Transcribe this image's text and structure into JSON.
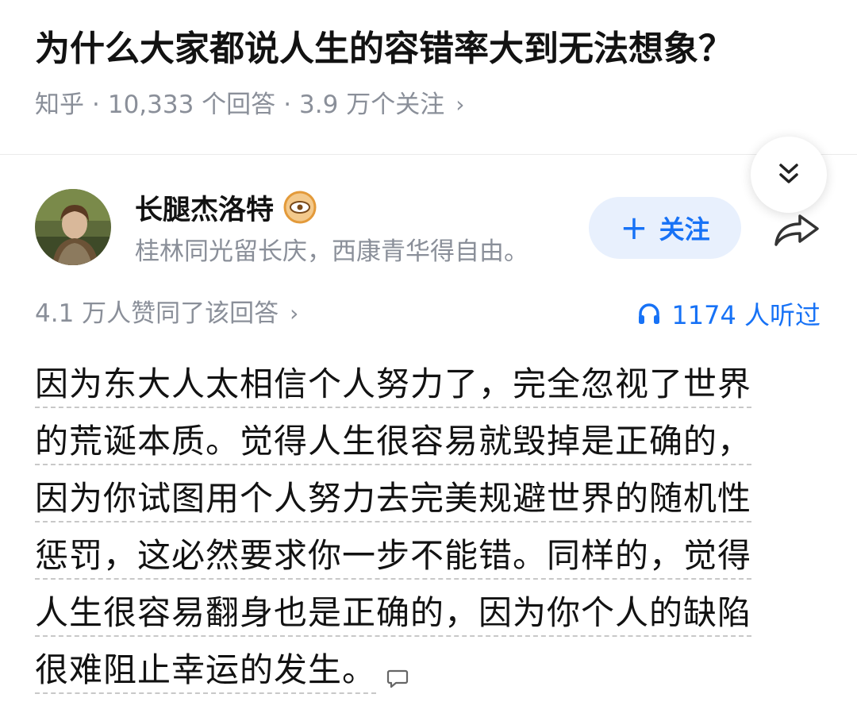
{
  "question": {
    "title": "为什么大家都说人生的容错率大到无法想象？",
    "source": "知乎",
    "answer_count": "10,333 个回答",
    "follower_count": "3.9 万个关注"
  },
  "author": {
    "name": "长腿杰洛特",
    "bio": "桂林同光留长庆，西康青华得自由。",
    "follow_label": "关注"
  },
  "stats": {
    "upvotes": "4.1 万人赞同了该回答",
    "listens": "1174 人听过"
  },
  "answer": {
    "lines": [
      "因为东大人太相信个人努力了，完全忽视了世界",
      "的荒诞本质。觉得人生很容易就毁掉是正确的，",
      "因为你试图用个人努力去完美规避世界的随机性",
      "惩罚，这必然要求你一步不能错。同样的，觉得",
      "人生很容易翻身也是正确的，因为你个人的缺陷",
      "很难阻止幸运的发生。"
    ]
  },
  "colors": {
    "accent": "#1772f6",
    "follow_bg": "#e8f0fd",
    "muted_text": "#8a8f99",
    "title_text": "#121212"
  },
  "icons": {
    "collapse": "double-chevron-down-icon",
    "share": "share-arrow-icon",
    "verified": "eye-badge-icon",
    "listen": "headphones-icon",
    "comment": "comment-bubble-icon"
  }
}
